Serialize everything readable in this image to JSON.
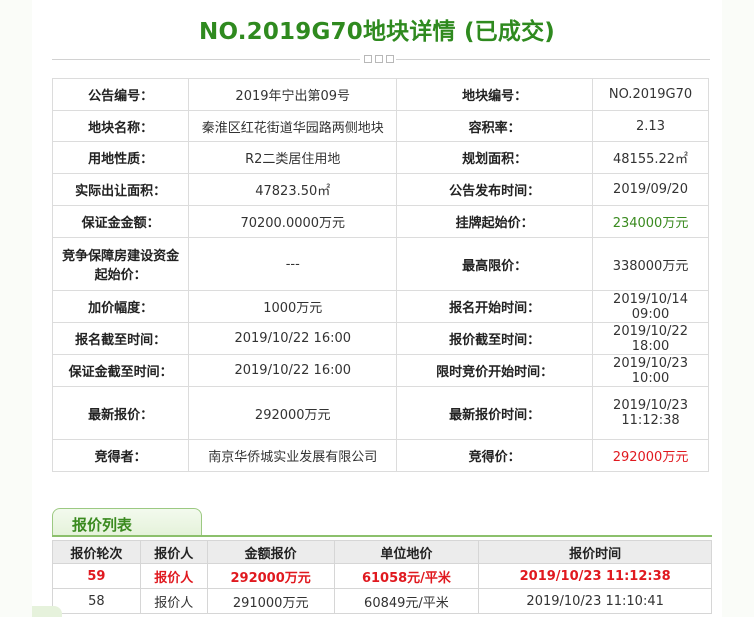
{
  "header": {
    "title": "NO.2019G70地块详情 (已成交)"
  },
  "info_rows": [
    {
      "l1": "公告编号：",
      "v1": "2019年宁出第09号",
      "l2": "地块编号：",
      "v2": "NO.2019G70"
    },
    {
      "l1": "地块名称：",
      "v1": "秦淮区红花街道华园路两侧地块",
      "l2": "容积率：",
      "v2": "2.13"
    },
    {
      "l1": "用地性质：",
      "v1": "R2二类居住用地",
      "l2": "规划面积：",
      "v2": "48155.22㎡"
    },
    {
      "l1": "实际出让面积：",
      "v1": "47823.50㎡",
      "l2": "公告发布时间：",
      "v2": "2019/09/20"
    },
    {
      "l1": "保证金金额：",
      "v1": "70200.0000万元",
      "l2": "挂牌起始价：",
      "v2": "234000万元"
    },
    {
      "l1": "竞争保障房建设资金起始价：",
      "v1": "---",
      "l2": "最高限价：",
      "v2": "338000万元"
    },
    {
      "l1": "加价幅度：",
      "v1": "1000万元",
      "l2": "报名开始时间：",
      "v2": "2019/10/14 09:00"
    },
    {
      "l1": "报名截至时间：",
      "v1": "2019/10/22 16:00",
      "l2": "报价截至时间：",
      "v2": "2019/10/22 18:00"
    },
    {
      "l1": "保证金截至时间：",
      "v1": "2019/10/22 16:00",
      "l2": "限时竞价开始时间：",
      "v2": "2019/10/23 10:00"
    },
    {
      "l1": "最新报价：",
      "v1": "292000万元",
      "l2": "最新报价时间：",
      "v2": "2019/10/23 11:12:38"
    },
    {
      "l1": "竞得者：",
      "v1": "南京华侨城实业发展有限公司",
      "l2": "竞得价：",
      "v2": "292000万元"
    }
  ],
  "bid_section": {
    "tab_label": "报价列表",
    "columns": [
      "报价轮次",
      "报价人",
      "金额报价",
      "单位地价",
      "报价时间"
    ],
    "rows": [
      [
        "59",
        "报价人",
        "292000万元",
        "61058元/平米",
        "2019/10/23 11:12:38"
      ],
      [
        "58",
        "报价人",
        "291000万元",
        "60849元/平米",
        "2019/10/23 11:10:41"
      ]
    ]
  },
  "colors": {
    "title_green": "#2f8a1f",
    "start_price_green": "#3a8a1f",
    "winning_red": "#e0191f"
  }
}
